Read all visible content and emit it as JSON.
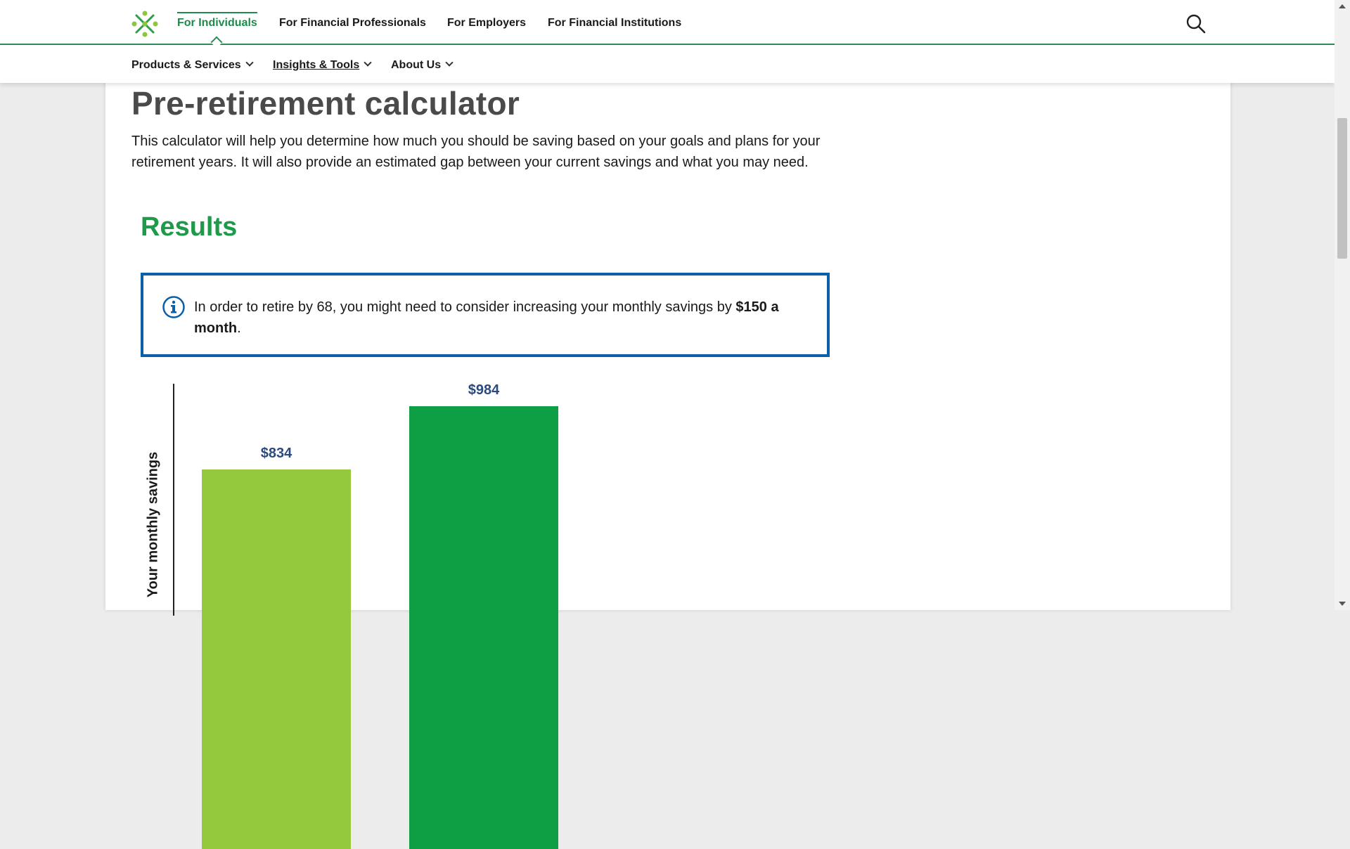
{
  "top_nav": {
    "logo_icon": "ascensus-logo-icon",
    "links": [
      {
        "label": "For Individuals",
        "active": true
      },
      {
        "label": "For Financial Professionals",
        "active": false
      },
      {
        "label": "For Employers",
        "active": false
      },
      {
        "label": "For Financial Institutions",
        "active": false
      }
    ],
    "search_icon": "search-icon"
  },
  "sub_nav": {
    "items": [
      {
        "label": "Products & Services",
        "icon": "chevron-down-icon"
      },
      {
        "label": "Insights & Tools",
        "icon": "chevron-down-icon"
      },
      {
        "label": "About Us",
        "icon": "chevron-down-icon"
      }
    ]
  },
  "content": {
    "title": "Pre-retirement calculator",
    "intro": "This calculator will help you determine how much you should be saving based on your goals and plans for your retirement years. It will also provide an estimated gap between your current savings and what you may need.",
    "results_heading": "Results",
    "alert": {
      "icon": "info-icon",
      "text_prefix": "In order to retire by 68, you might need to consider increasing your monthly savings by ",
      "text_bold": "$150 a month",
      "text_suffix": "."
    }
  },
  "chart_data": {
    "type": "bar",
    "ylabel": "Your monthly savings",
    "values": [
      834,
      984
    ],
    "value_labels": [
      "$834",
      "$984"
    ],
    "colors": [
      "#94c83d",
      "#0e9f45"
    ]
  }
}
